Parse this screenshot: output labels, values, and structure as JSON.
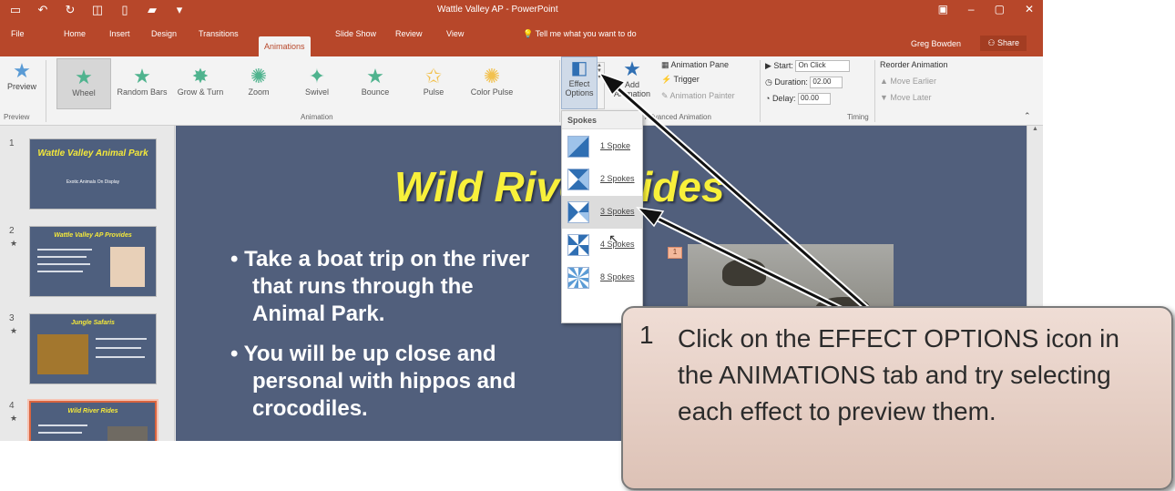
{
  "window": {
    "title": "Wattle Valley AP - PowerPoint"
  },
  "tabs": [
    {
      "label": "File"
    },
    {
      "label": "Home"
    },
    {
      "label": "Insert"
    },
    {
      "label": "Design"
    },
    {
      "label": "Transitions"
    },
    {
      "label": "Animations"
    },
    {
      "label": "Slide Show"
    },
    {
      "label": "Review"
    },
    {
      "label": "View"
    }
  ],
  "tell_me": "Tell me what you want to do",
  "user": {
    "name": "Greg Bowden",
    "share": "Share"
  },
  "ribbon": {
    "preview": "Preview",
    "preview_group": "Preview",
    "animation_group": "Animation",
    "advanced_group": "Advanced Animation",
    "timing_group": "Timing",
    "effects": [
      {
        "label": "Wheel"
      },
      {
        "label": "Random Bars"
      },
      {
        "label": "Grow & Turn"
      },
      {
        "label": "Zoom"
      },
      {
        "label": "Swivel"
      },
      {
        "label": "Bounce"
      },
      {
        "label": "Pulse"
      },
      {
        "label": "Color Pulse"
      }
    ],
    "effect_options": "Effect Options",
    "add_animation": "Add Animation",
    "animation_pane": "Animation Pane",
    "trigger": "Trigger",
    "animation_painter": "Animation Painter",
    "start_label": "Start:",
    "start_value": "On Click",
    "duration_label": "Duration:",
    "duration_value": "02.00",
    "delay_label": "Delay:",
    "delay_value": "00.00",
    "reorder": "Reorder Animation",
    "move_earlier": "Move Earlier",
    "move_later": "Move Later"
  },
  "thumbnails": [
    {
      "num": "1",
      "title": "Wattle Valley Animal Park",
      "subtitle": "Exotic Animals On Display"
    },
    {
      "num": "2",
      "title": "Wattle Valley AP Provides"
    },
    {
      "num": "3",
      "title": "Jungle Safaris"
    },
    {
      "num": "4",
      "title": "Wild River Rides"
    }
  ],
  "slide": {
    "title": "Wild River Rides",
    "bullet1": "• Take a boat trip on the river",
    "bullet1b": "that runs through the",
    "bullet1c": "Animal Park.",
    "bullet2": "• You will be up close and",
    "bullet2b": "personal with hippos and",
    "bullet2c": "crocodiles.",
    "anim_tag": "1"
  },
  "dropdown": {
    "header": "Spokes",
    "items": [
      {
        "label": "1 Spoke"
      },
      {
        "label": "2 Spokes"
      },
      {
        "label": "3 Spokes"
      },
      {
        "label": "4 Spokes"
      },
      {
        "label": "8 Spokes"
      }
    ]
  },
  "callout": {
    "number": "1",
    "text": "Click on the EFFECT OPTIONS icon in the ANIMATIONS tab and try selecting each effect to preview them."
  }
}
